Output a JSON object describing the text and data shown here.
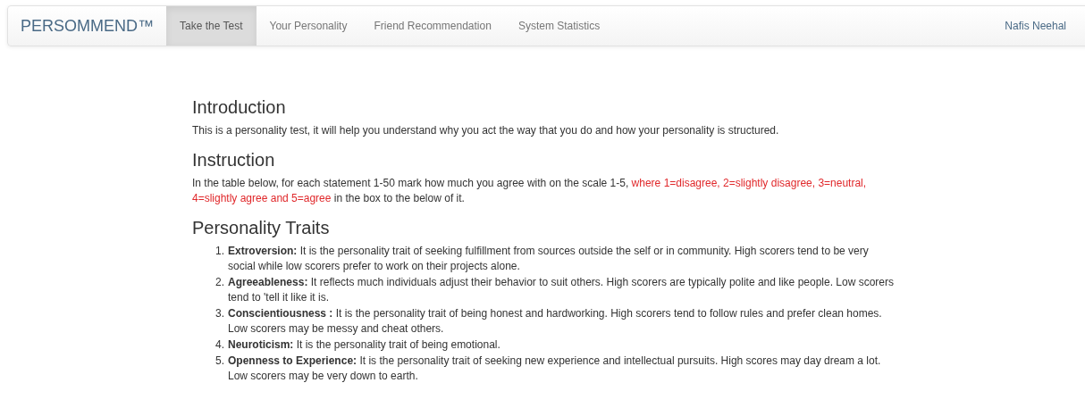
{
  "navbar": {
    "brand": "PERSOMMEND™",
    "tabs": [
      {
        "label": "Take the Test",
        "selected": true
      },
      {
        "label": "Your Personality",
        "selected": false
      },
      {
        "label": "Friend Recommendation",
        "selected": false
      },
      {
        "label": "System Statistics",
        "selected": false
      }
    ],
    "user": "Nafis Neehal"
  },
  "introduction": {
    "heading": "Introduction",
    "text": "This is a personality test, it will help you understand why you act the way that you do and how your personality is structured."
  },
  "instruction": {
    "heading": "Instruction",
    "text_before": "In the table below, for each statement 1-50 mark how much you agree with on the scale 1-5, ",
    "highlight": "where 1=disagree, 2=slightly disagree, 3=neutral, 4=slightly agree and 5=agree",
    "text_after": " in the box to the below of it."
  },
  "traits": {
    "heading": "Personality Traits",
    "items": [
      {
        "number": "1.",
        "text": "**Extroversion:** It is the personality trait of seeking fulfillment from sources outside the self or in community. High scorers tend to be very social while low scorers prefer to work on their projects alone."
      },
      {
        "number": "2.",
        "text": "**Agreeableness:** It reflects much individuals adjust their behavior to suit others. High scorers are typically polite and like people. Low scorers tend to 'tell it like it is."
      },
      {
        "number": "3.",
        "text": "**Conscientiousness :** It is the personality trait of being honest and hardworking. High scorers tend to follow rules and prefer clean homes. Low scorers may be messy and cheat others."
      },
      {
        "number": "4.",
        "text": "**Neuroticism:** It is the personality trait of being emotional."
      },
      {
        "number": "5.",
        "text": "**Openness to Experience:** It is the personality trait of seeking new experience and intellectual pursuits. High scores may day dream a lot. Low scorers may be very down to earth."
      }
    ]
  }
}
